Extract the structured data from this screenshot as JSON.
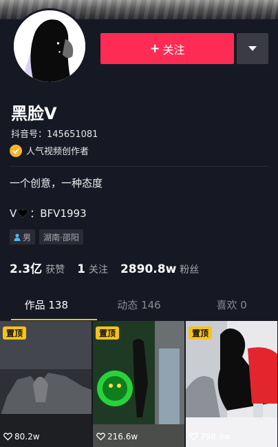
{
  "profile": {
    "follow_label": "关注",
    "nickname": "黑脸V",
    "douyin_id": "抖音号：145651081",
    "creator_label": "人气视频创作者",
    "bio": "一个创意，一种态度",
    "v_prefix": "V",
    "v_suffix": "：BFV1993",
    "gender": "男",
    "location": "湖南·邵阳"
  },
  "stats": {
    "likes_num": "2.3亿",
    "likes_label": "获赞",
    "following_num": "1",
    "following_label": "关注",
    "fans_num": "2890.8w",
    "fans_label": "粉丝"
  },
  "tabs": [
    {
      "label": "作品 138",
      "active": true
    },
    {
      "label": "动态 146",
      "active": false
    },
    {
      "label": "喜欢 0",
      "active": false
    }
  ],
  "videos": [
    {
      "pin": "置顶",
      "likes": "80.2w"
    },
    {
      "pin": "置顶",
      "likes": "216.6w"
    },
    {
      "pin": "置顶",
      "likes": "798.9w"
    }
  ],
  "colors": {
    "background": "#161823",
    "accent": "#fe2c55",
    "highlight": "#f9c21b"
  }
}
